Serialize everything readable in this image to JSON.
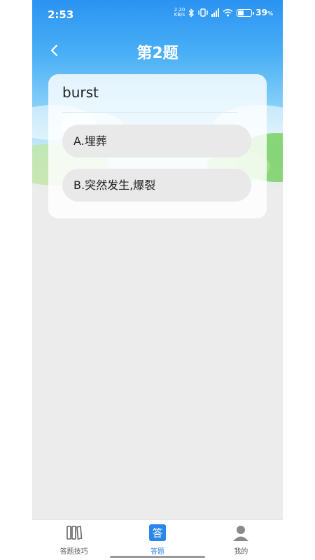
{
  "status_bar": {
    "time": "2:53",
    "net_speed_value": "2.20",
    "net_speed_unit": "KB/s",
    "battery_percent": "39",
    "battery_unit": "%",
    "battery_level": 0.39
  },
  "header": {
    "title": "第2题",
    "back_icon": "chevron-left-icon"
  },
  "question": {
    "word": "burst",
    "options": [
      {
        "label": "A.埋葬"
      },
      {
        "label": "B.突然发生,爆裂"
      }
    ]
  },
  "tab_bar": {
    "tabs": [
      {
        "label": "答题技巧",
        "icon": "books-icon"
      },
      {
        "label": "答题",
        "icon": "answer-icon",
        "icon_text": "答"
      },
      {
        "label": "我的",
        "icon": "person-icon"
      }
    ],
    "active_index": 1
  },
  "colors": {
    "primary": "#2a86ea",
    "sky_top": "#2a93f2",
    "background": "#ececec",
    "option_bg": "#e9e9e9"
  }
}
